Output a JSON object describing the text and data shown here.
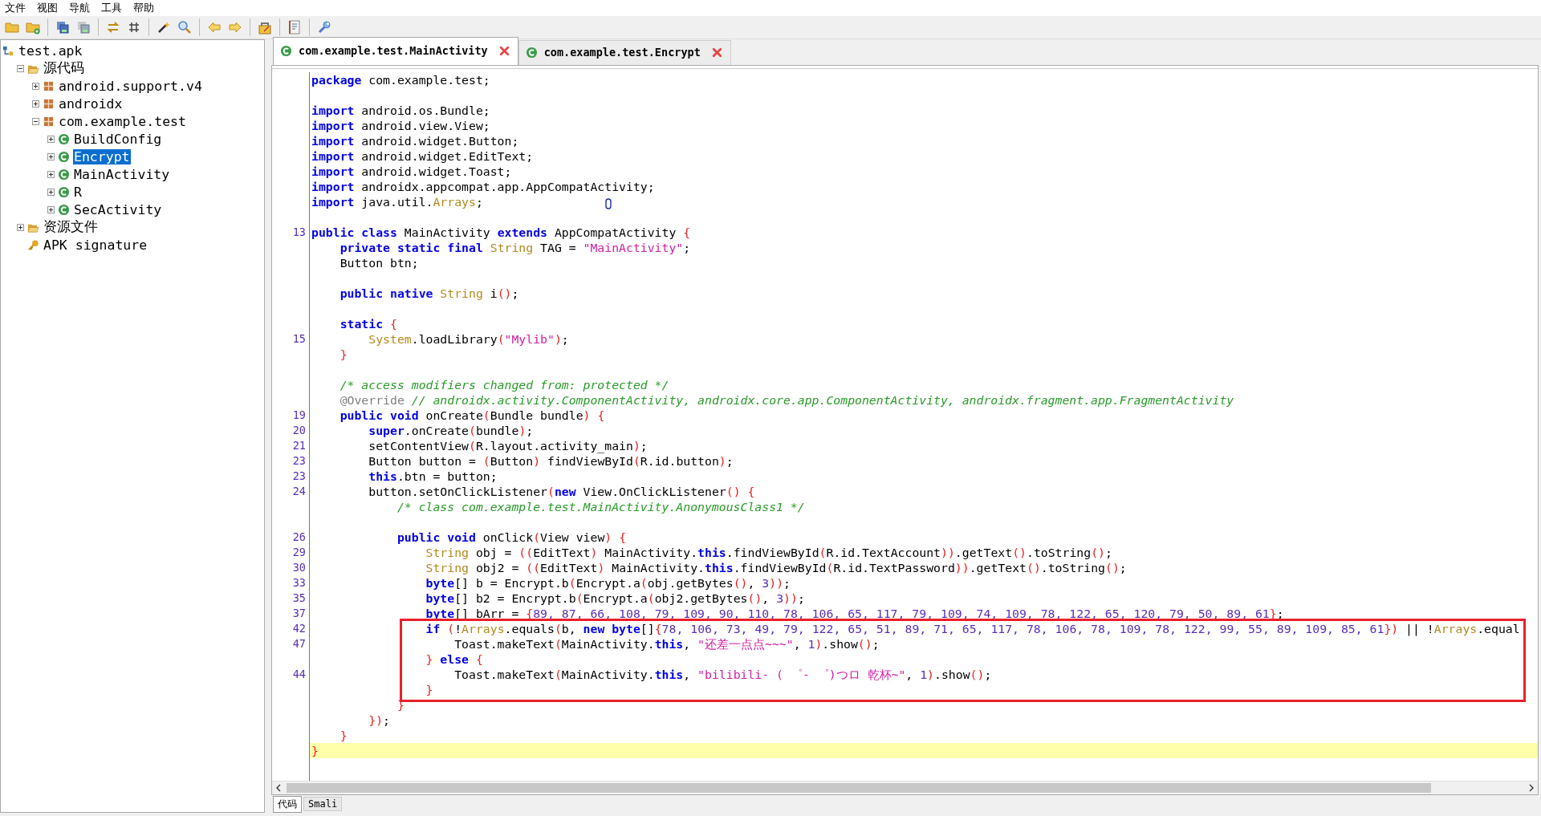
{
  "menu": [
    "文件",
    "视图",
    "导航",
    "工具",
    "帮助"
  ],
  "tree": [
    {
      "label": "test.apk",
      "kind": "project",
      "selected": false,
      "children": [
        {
          "label": "源代码",
          "kind": "source-folder",
          "expanded": true,
          "selected": false,
          "children": [
            {
              "label": "android.support.v4",
              "kind": "package",
              "expanded": false,
              "selected": false
            },
            {
              "label": "androidx",
              "kind": "package",
              "expanded": false,
              "selected": false
            },
            {
              "label": "com.example.test",
              "kind": "package",
              "expanded": true,
              "selected": false,
              "children": [
                {
                  "label": "BuildConfig",
                  "kind": "class",
                  "expanded": false,
                  "selected": false
                },
                {
                  "label": "Encrypt",
                  "kind": "class",
                  "expanded": false,
                  "selected": true
                },
                {
                  "label": "MainActivity",
                  "kind": "class",
                  "expanded": false,
                  "selected": false
                },
                {
                  "label": "R",
                  "kind": "class",
                  "expanded": false,
                  "selected": false
                },
                {
                  "label": "SecActivity",
                  "kind": "class",
                  "expanded": false,
                  "selected": false
                }
              ]
            }
          ]
        },
        {
          "label": "资源文件",
          "kind": "resource-folder",
          "expanded": false,
          "selected": false
        },
        {
          "label": "APK signature",
          "kind": "key",
          "selected": false
        }
      ]
    }
  ],
  "tabs": [
    {
      "label": "com.example.test.MainActivity",
      "selected": true
    },
    {
      "label": "com.example.test.Encrypt",
      "selected": false
    }
  ],
  "code": [
    {
      "current": false,
      "t": [
        {
          "kind": "keyword",
          "text": "package"
        },
        {
          "kind": "plain",
          "text": " com.example.test;"
        }
      ]
    },
    {
      "current": false
    },
    {
      "current": false,
      "t": [
        {
          "kind": "keyword",
          "text": "import"
        },
        {
          "kind": "plain",
          "text": " android.os.Bundle;"
        }
      ]
    },
    {
      "current": false,
      "t": [
        {
          "kind": "keyword",
          "text": "import"
        },
        {
          "kind": "plain",
          "text": " android.view.View;"
        }
      ]
    },
    {
      "current": false,
      "t": [
        {
          "kind": "keyword",
          "text": "import"
        },
        {
          "kind": "plain",
          "text": " android.widget.Button;"
        }
      ]
    },
    {
      "current": false,
      "t": [
        {
          "kind": "keyword",
          "text": "import"
        },
        {
          "kind": "plain",
          "text": " android.widget.EditText;"
        }
      ]
    },
    {
      "current": false,
      "t": [
        {
          "kind": "keyword",
          "text": "import"
        },
        {
          "kind": "plain",
          "text": " android.widget.Toast;"
        }
      ]
    },
    {
      "current": false,
      "t": [
        {
          "kind": "keyword",
          "text": "import"
        },
        {
          "kind": "plain",
          "text": " androidx.appcompat.app.AppCompatActivity;"
        }
      ]
    },
    {
      "current": false,
      "t": [
        {
          "kind": "keyword",
          "text": "import"
        },
        {
          "kind": "plain",
          "text": " java.util."
        },
        {
          "kind": "type",
          "text": "Arrays"
        },
        {
          "kind": "plain",
          "text": ";"
        }
      ]
    },
    {
      "current": false
    },
    {
      "n": "13",
      "current": false,
      "t": [
        {
          "kind": "keyword",
          "text": "public class"
        },
        {
          "kind": "plain",
          "text": " MainActivity "
        },
        {
          "kind": "keyword",
          "text": "extends"
        },
        {
          "kind": "plain",
          "text": " AppCompatActivity "
        },
        {
          "kind": "bracket",
          "text": "{"
        }
      ]
    },
    {
      "current": false,
      "t": [
        {
          "kind": "keyword",
          "text": "    private static final"
        },
        {
          "kind": "type",
          "text": " String"
        },
        {
          "kind": "plain",
          "text": " TAG = "
        },
        {
          "kind": "string",
          "text": "\"MainActivity\""
        },
        {
          "kind": "plain",
          "text": ";"
        }
      ]
    },
    {
      "current": false,
      "t": [
        {
          "kind": "plain",
          "text": "    Button btn;"
        }
      ]
    },
    {
      "current": false
    },
    {
      "current": false,
      "t": [
        {
          "kind": "keyword",
          "text": "    public native"
        },
        {
          "kind": "type",
          "text": " String"
        },
        {
          "kind": "plain",
          "text": " i"
        },
        {
          "kind": "bracket",
          "text": "()"
        },
        {
          "kind": "plain",
          "text": ";"
        }
      ]
    },
    {
      "current": false
    },
    {
      "current": false,
      "t": [
        {
          "kind": "keyword",
          "text": "    static"
        },
        {
          "kind": "bracket",
          "text": " {"
        }
      ]
    },
    {
      "n": "15",
      "current": false,
      "t": [
        {
          "kind": "type",
          "text": "        System"
        },
        {
          "kind": "plain",
          "text": ".loadLibrary"
        },
        {
          "kind": "bracket",
          "text": "("
        },
        {
          "kind": "string",
          "text": "\"Mylib\""
        },
        {
          "kind": "bracket",
          "text": ")"
        },
        {
          "kind": "plain",
          "text": ";"
        }
      ]
    },
    {
      "current": false,
      "t": [
        {
          "kind": "bracket",
          "text": "    }"
        }
      ]
    },
    {
      "current": false
    },
    {
      "current": false,
      "t": [
        {
          "kind": "comment",
          "text": "    /* access modifiers changed from: protected */"
        }
      ]
    },
    {
      "current": false,
      "t": [
        {
          "kind": "annotation",
          "text": "    @Override"
        },
        {
          "kind": "comment",
          "text": " // androidx.activity.ComponentActivity, androidx.core.app.ComponentActivity, androidx.fragment.app.FragmentActivity"
        }
      ]
    },
    {
      "n": "19",
      "current": false,
      "t": [
        {
          "kind": "keyword",
          "text": "    public void"
        },
        {
          "kind": "plain",
          "text": " onCreate"
        },
        {
          "kind": "bracket",
          "text": "("
        },
        {
          "kind": "plain",
          "text": "Bundle bundle"
        },
        {
          "kind": "bracket",
          "text": ")"
        },
        {
          "kind": "bracket",
          "text": " {"
        }
      ]
    },
    {
      "n": "20",
      "current": false,
      "t": [
        {
          "kind": "keyword",
          "text": "        super"
        },
        {
          "kind": "plain",
          "text": ".onCreate"
        },
        {
          "kind": "bracket",
          "text": "("
        },
        {
          "kind": "plain",
          "text": "bundle"
        },
        {
          "kind": "bracket",
          "text": ")"
        },
        {
          "kind": "plain",
          "text": ";"
        }
      ]
    },
    {
      "n": "21",
      "current": false,
      "t": [
        {
          "kind": "plain",
          "text": "        setContentView"
        },
        {
          "kind": "bracket",
          "text": "("
        },
        {
          "kind": "plain",
          "text": "R.layout.activity_main"
        },
        {
          "kind": "bracket",
          "text": ")"
        },
        {
          "kind": "plain",
          "text": ";"
        }
      ]
    },
    {
      "n": "23",
      "current": false,
      "t": [
        {
          "kind": "plain",
          "text": "        Button button = "
        },
        {
          "kind": "bracket",
          "text": "("
        },
        {
          "kind": "plain",
          "text": "Button"
        },
        {
          "kind": "bracket",
          "text": ")"
        },
        {
          "kind": "plain",
          "text": " findViewById"
        },
        {
          "kind": "bracket",
          "text": "("
        },
        {
          "kind": "plain",
          "text": "R.id.button"
        },
        {
          "kind": "bracket",
          "text": ")"
        },
        {
          "kind": "plain",
          "text": ";"
        }
      ]
    },
    {
      "n": "23",
      "current": false,
      "t": [
        {
          "kind": "keyword",
          "text": "        this"
        },
        {
          "kind": "plain",
          "text": ".btn = button;"
        }
      ]
    },
    {
      "n": "24",
      "current": false,
      "t": [
        {
          "kind": "plain",
          "text": "        button.setOnClickListener"
        },
        {
          "kind": "bracket",
          "text": "("
        },
        {
          "kind": "keyword",
          "text": "new"
        },
        {
          "kind": "plain",
          "text": " View.OnClickListener"
        },
        {
          "kind": "bracket",
          "text": "()"
        },
        {
          "kind": "bracket",
          "text": " {"
        }
      ]
    },
    {
      "current": false,
      "t": [
        {
          "kind": "comment",
          "text": "            /* class com.example.test.MainActivity.AnonymousClass1 */"
        }
      ]
    },
    {
      "current": false
    },
    {
      "n": "26",
      "current": false,
      "t": [
        {
          "kind": "keyword",
          "text": "            public void"
        },
        {
          "kind": "plain",
          "text": " onClick"
        },
        {
          "kind": "bracket",
          "text": "("
        },
        {
          "kind": "plain",
          "text": "View view"
        },
        {
          "kind": "bracket",
          "text": ")"
        },
        {
          "kind": "bracket",
          "text": " {"
        }
      ]
    },
    {
      "n": "29",
      "current": false,
      "t": [
        {
          "kind": "type",
          "text": "                String"
        },
        {
          "kind": "plain",
          "text": " obj = "
        },
        {
          "kind": "bracket",
          "text": "(("
        },
        {
          "kind": "plain",
          "text": "EditText"
        },
        {
          "kind": "bracket",
          "text": ")"
        },
        {
          "kind": "plain",
          "text": " MainActivity."
        },
        {
          "kind": "keyword",
          "text": "this"
        },
        {
          "kind": "plain",
          "text": ".findViewById"
        },
        {
          "kind": "bracket",
          "text": "("
        },
        {
          "kind": "plain",
          "text": "R.id.TextAccount"
        },
        {
          "kind": "bracket",
          "text": "))"
        },
        {
          "kind": "plain",
          "text": ".getText"
        },
        {
          "kind": "bracket",
          "text": "()"
        },
        {
          "kind": "plain",
          "text": ".toString"
        },
        {
          "kind": "bracket",
          "text": "()"
        },
        {
          "kind": "plain",
          "text": ";"
        }
      ]
    },
    {
      "n": "30",
      "current": false,
      "t": [
        {
          "kind": "type",
          "text": "                String"
        },
        {
          "kind": "plain",
          "text": " obj2 = "
        },
        {
          "kind": "bracket",
          "text": "(("
        },
        {
          "kind": "plain",
          "text": "EditText"
        },
        {
          "kind": "bracket",
          "text": ")"
        },
        {
          "kind": "plain",
          "text": " MainActivity."
        },
        {
          "kind": "keyword",
          "text": "this"
        },
        {
          "kind": "plain",
          "text": ".findViewById"
        },
        {
          "kind": "bracket",
          "text": "("
        },
        {
          "kind": "plain",
          "text": "R.id.TextPassword"
        },
        {
          "kind": "bracket",
          "text": "))"
        },
        {
          "kind": "plain",
          "text": ".getText"
        },
        {
          "kind": "bracket",
          "text": "()"
        },
        {
          "kind": "plain",
          "text": ".toString"
        },
        {
          "kind": "bracket",
          "text": "()"
        },
        {
          "kind": "plain",
          "text": ";"
        }
      ]
    },
    {
      "n": "33",
      "current": false,
      "t": [
        {
          "kind": "keyword",
          "text": "                byte"
        },
        {
          "kind": "plain",
          "text": "[] b = Encrypt.b"
        },
        {
          "kind": "bracket",
          "text": "("
        },
        {
          "kind": "plain",
          "text": "Encrypt.a"
        },
        {
          "kind": "bracket",
          "text": "("
        },
        {
          "kind": "plain",
          "text": "obj.getBytes"
        },
        {
          "kind": "bracket",
          "text": "()"
        },
        {
          "kind": "plain",
          "text": ", "
        },
        {
          "kind": "number",
          "text": "3"
        },
        {
          "kind": "bracket",
          "text": "))"
        },
        {
          "kind": "plain",
          "text": ";"
        }
      ]
    },
    {
      "n": "35",
      "current": false,
      "t": [
        {
          "kind": "keyword",
          "text": "                byte"
        },
        {
          "kind": "plain",
          "text": "[] b2 = Encrypt.b"
        },
        {
          "kind": "bracket",
          "text": "("
        },
        {
          "kind": "plain",
          "text": "Encrypt.a"
        },
        {
          "kind": "bracket",
          "text": "("
        },
        {
          "kind": "plain",
          "text": "obj2.getBytes"
        },
        {
          "kind": "bracket",
          "text": "()"
        },
        {
          "kind": "plain",
          "text": ", "
        },
        {
          "kind": "number",
          "text": "3"
        },
        {
          "kind": "bracket",
          "text": "))"
        },
        {
          "kind": "plain",
          "text": ";"
        }
      ]
    },
    {
      "n": "37",
      "current": false,
      "t": [
        {
          "kind": "keyword",
          "text": "                byte"
        },
        {
          "kind": "plain",
          "text": "[] bArr = "
        },
        {
          "kind": "bracket",
          "text": "{"
        },
        {
          "kind": "number",
          "text": "89, 87, 66, 108, 79, 109, 90, 110, 78, 106, 65, 117, 79, 109, 74, 109, 78, 122, 65, 120, 79, 50, 89, 61"
        },
        {
          "kind": "bracket",
          "text": "}"
        },
        {
          "kind": "plain",
          "text": ";"
        }
      ]
    },
    {
      "n": "42",
      "current": false,
      "t": [
        {
          "kind": "keyword",
          "text": "                if"
        },
        {
          "kind": "bracket",
          "text": " ("
        },
        {
          "kind": "plain",
          "text": "!"
        },
        {
          "kind": "type",
          "text": "Arrays"
        },
        {
          "kind": "plain",
          "text": ".equals"
        },
        {
          "kind": "bracket",
          "text": "("
        },
        {
          "kind": "plain",
          "text": "b, "
        },
        {
          "kind": "keyword",
          "text": "new byte"
        },
        {
          "kind": "plain",
          "text": "[]"
        },
        {
          "kind": "bracket",
          "text": "{"
        },
        {
          "kind": "number",
          "text": "78, 106, 73, 49, 79, 122, 65, 51, 89, 71, 65, 117, 78, 106, 78, 109, 78, 122, 99, 55, 89, 109, 85, 61"
        },
        {
          "kind": "bracket",
          "text": "})"
        },
        {
          "kind": "plain",
          "text": " || !"
        },
        {
          "kind": "type",
          "text": "Arrays"
        },
        {
          "kind": "plain",
          "text": ".equal"
        }
      ]
    },
    {
      "n": "47",
      "current": false,
      "t": [
        {
          "kind": "plain",
          "text": "                    Toast.makeText"
        },
        {
          "kind": "bracket",
          "text": "("
        },
        {
          "kind": "plain",
          "text": "MainActivity."
        },
        {
          "kind": "keyword",
          "text": "this"
        },
        {
          "kind": "plain",
          "text": ", "
        },
        {
          "kind": "string",
          "text": "\"还差一点点~~~\""
        },
        {
          "kind": "plain",
          "text": ", "
        },
        {
          "kind": "number",
          "text": "1"
        },
        {
          "kind": "bracket",
          "text": ")"
        },
        {
          "kind": "plain",
          "text": ".show"
        },
        {
          "kind": "bracket",
          "text": "()"
        },
        {
          "kind": "plain",
          "text": ";"
        }
      ]
    },
    {
      "current": false,
      "t": [
        {
          "kind": "bracket",
          "text": "                }"
        },
        {
          "kind": "keyword",
          "text": " else"
        },
        {
          "kind": "bracket",
          "text": " {"
        }
      ]
    },
    {
      "n": "44",
      "current": false,
      "t": [
        {
          "kind": "plain",
          "text": "                    Toast.makeText"
        },
        {
          "kind": "bracket",
          "text": "("
        },
        {
          "kind": "plain",
          "text": "MainActivity."
        },
        {
          "kind": "keyword",
          "text": "this"
        },
        {
          "kind": "plain",
          "text": ", "
        },
        {
          "kind": "string",
          "text": "\"bilibili- ( ゜- ゜)つロ 乾杯~\""
        },
        {
          "kind": "plain",
          "text": ", "
        },
        {
          "kind": "number",
          "text": "1"
        },
        {
          "kind": "bracket",
          "text": ")"
        },
        {
          "kind": "plain",
          "text": ".show"
        },
        {
          "kind": "bracket",
          "text": "()"
        },
        {
          "kind": "plain",
          "text": ";"
        }
      ]
    },
    {
      "current": false,
      "t": [
        {
          "kind": "bracket",
          "text": "                }"
        }
      ]
    },
    {
      "current": false,
      "t": [
        {
          "kind": "bracket",
          "text": "            }"
        }
      ]
    },
    {
      "current": false,
      "t": [
        {
          "kind": "bracket",
          "text": "        })"
        },
        {
          "kind": "plain",
          "text": ";"
        }
      ]
    },
    {
      "current": false,
      "t": [
        {
          "kind": "bracket",
          "text": "    }"
        }
      ]
    },
    {
      "current": true,
      "t": [
        {
          "kind": "bracket",
          "text": "}"
        }
      ]
    }
  ],
  "bottom_tabs": [
    {
      "label": "代码",
      "selected": true
    },
    {
      "label": "Smali",
      "selected": false
    }
  ]
}
